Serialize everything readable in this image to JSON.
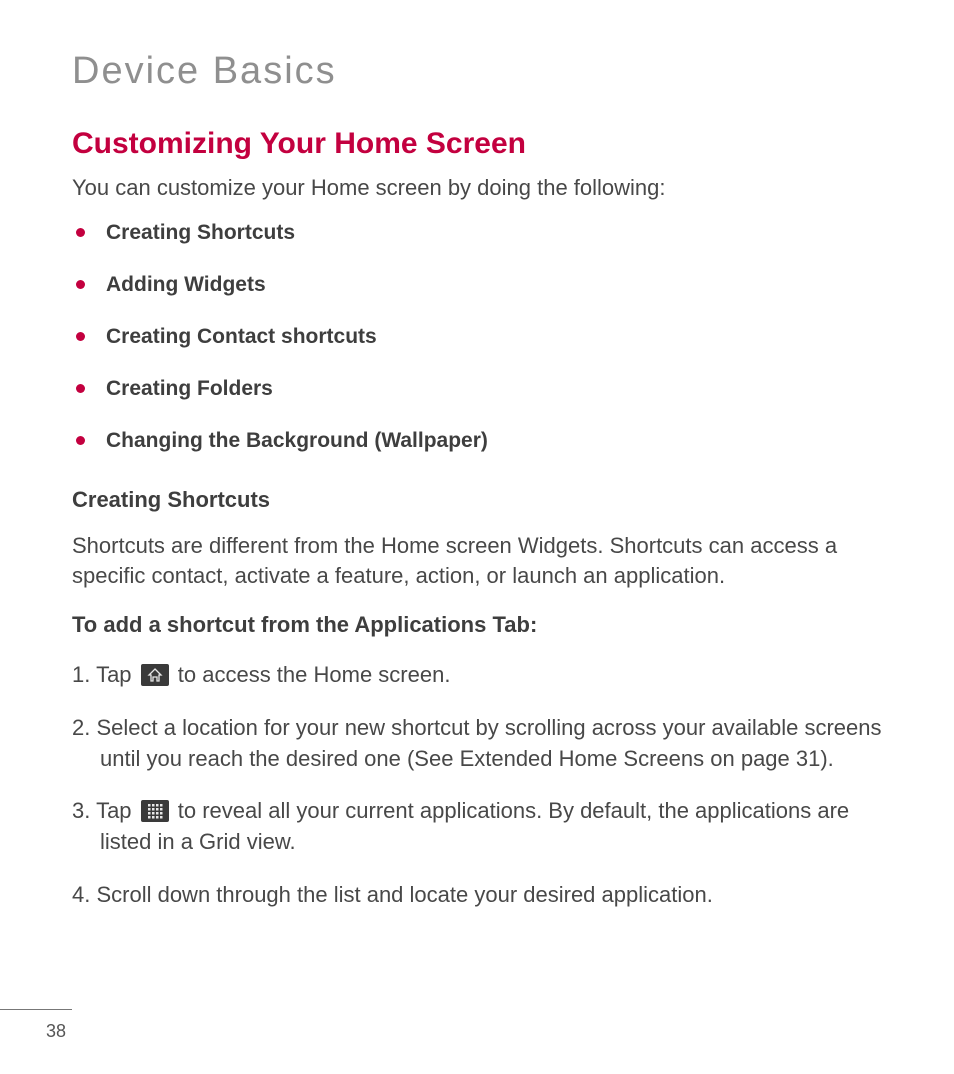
{
  "chapter": "Device Basics",
  "section_title": "Customizing Your Home Screen",
  "intro": "You can customize your Home screen by doing the following:",
  "bullets": [
    "Creating Shortcuts",
    "Adding Widgets",
    "Creating Contact shortcuts",
    "Creating Folders",
    "Changing the Background (Wallpaper)"
  ],
  "subsection_title": "Creating Shortcuts",
  "subsection_intro": "Shortcuts are different from the Home screen Widgets. Shortcuts can access a specific contact, activate a feature, action, or launch an application.",
  "instruction_heading": "To add a shortcut from the Applications Tab:",
  "steps": {
    "s1_a": "1. Tap ",
    "s1_b": " to access the Home screen.",
    "s2": "2. Select a location for your new shortcut by scrolling across your available screens until you reach the desired one (See Extended Home Screens on page 31).",
    "s3_a": "3. Tap ",
    "s3_b": " to reveal all your current applications. By default, the applications are listed in a Grid view.",
    "s4": "4. Scroll down through the list and locate your desired application."
  },
  "page_number": "38"
}
